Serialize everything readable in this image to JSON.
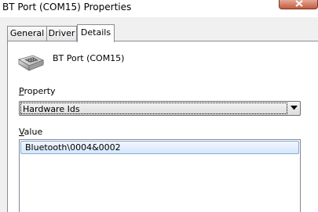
{
  "window": {
    "title": "BT Port (COM15) Properties"
  },
  "tabs": [
    {
      "label": "General"
    },
    {
      "label": "Driver"
    },
    {
      "label": "Details"
    }
  ],
  "device": {
    "name": "BT Port (COM15)",
    "icon": "serial-port-icon"
  },
  "property": {
    "label": "Property",
    "label_access_key": "P",
    "label_rest": "roperty",
    "selected": "Hardware Ids"
  },
  "value": {
    "label": "Value",
    "label_access_key": "V",
    "label_rest": "alue",
    "items": [
      "Bluetooth\\0004&0002"
    ]
  }
}
